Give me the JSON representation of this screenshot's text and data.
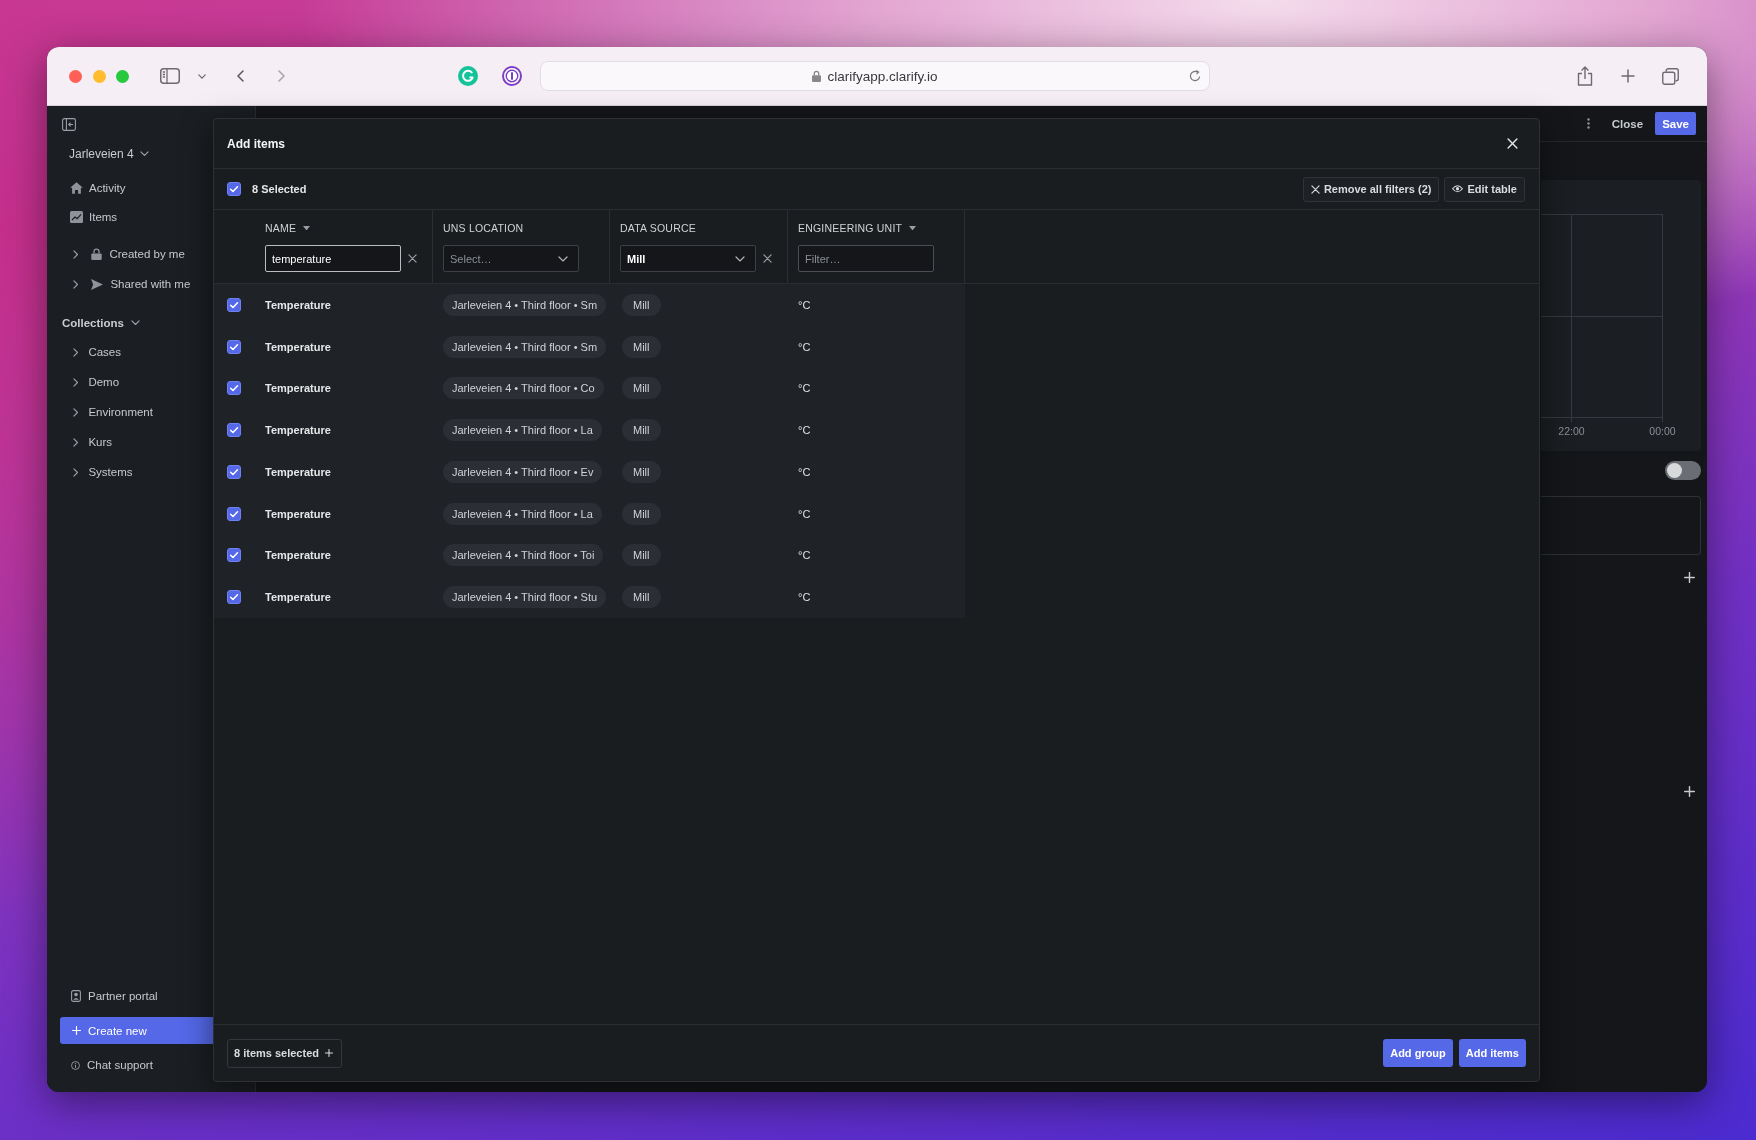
{
  "browser": {
    "url": "clarifyapp.clarify.io"
  },
  "sidebar": {
    "workspace": "Jarleveien 4",
    "nav": [
      {
        "label": "Activity"
      },
      {
        "label": "Items"
      }
    ],
    "shared": [
      {
        "label": "Created by me",
        "expanded": false
      },
      {
        "label": "Shared with me",
        "expanded": false
      }
    ],
    "collections": {
      "title": "Collections",
      "expanded": true,
      "items": [
        {
          "label": "Cases",
          "expanded": false
        },
        {
          "label": "Demo",
          "expanded": false
        },
        {
          "label": "Environment",
          "expanded": false
        },
        {
          "label": "Kurs",
          "expanded": false
        },
        {
          "label": "Systems",
          "expanded": false
        }
      ]
    },
    "footer": [
      {
        "kind": "link",
        "label": "Partner portal"
      },
      {
        "kind": "primary",
        "label": "Create new"
      },
      {
        "kind": "link",
        "label": "Chat support"
      }
    ]
  },
  "editor": {
    "actions": [
      {
        "kind": "dismiss",
        "label": "Close"
      },
      {
        "kind": "confirm",
        "label": "Save"
      }
    ],
    "chart": {
      "x_labels": [
        "22:00",
        "00:00"
      ]
    },
    "toggle": {
      "on": false
    }
  },
  "dialog": {
    "title": "Add items",
    "selection": {
      "checked": true,
      "label": "8 Selected"
    },
    "toolbar": [
      {
        "kind": "clear",
        "label": "Remove all filters (2)"
      },
      {
        "kind": "view",
        "label": "Edit table"
      }
    ],
    "table": {
      "columns": [
        {
          "label": "NAME",
          "sortable": true,
          "filter": {
            "kind": "text",
            "value": "temperature",
            "focused": true,
            "clearable": true
          }
        },
        {
          "label": "UNS LOCATION",
          "sortable": false,
          "filter": {
            "kind": "select",
            "placeholder": "Select…",
            "focused": false,
            "clearable": false
          }
        },
        {
          "label": "DATA SOURCE",
          "sortable": false,
          "filter": {
            "kind": "select",
            "value": "Mill",
            "focused": false,
            "clearable": true
          }
        },
        {
          "label": "ENGINEERING UNIT",
          "sortable": true,
          "filter": {
            "kind": "text",
            "placeholder": "Filter…",
            "focused": false,
            "clearable": false
          }
        }
      ],
      "rows": [
        {
          "selected": true,
          "name": "Temperature",
          "location": "Jarleveien 4 • Third floor • Sm",
          "source": "Mill",
          "unit": "°C"
        },
        {
          "selected": true,
          "name": "Temperature",
          "location": "Jarleveien 4 • Third floor • Sm",
          "source": "Mill",
          "unit": "°C"
        },
        {
          "selected": true,
          "name": "Temperature",
          "location": "Jarleveien 4 • Third floor • Co",
          "source": "Mill",
          "unit": "°C"
        },
        {
          "selected": true,
          "name": "Temperature",
          "location": "Jarleveien 4 • Third floor • La",
          "source": "Mill",
          "unit": "°C"
        },
        {
          "selected": true,
          "name": "Temperature",
          "location": "Jarleveien 4 • Third floor • Ev",
          "source": "Mill",
          "unit": "°C"
        },
        {
          "selected": true,
          "name": "Temperature",
          "location": "Jarleveien 4 • Third floor • La",
          "source": "Mill",
          "unit": "°C"
        },
        {
          "selected": true,
          "name": "Temperature",
          "location": "Jarleveien 4 • Third floor • Toi",
          "source": "Mill",
          "unit": "°C"
        },
        {
          "selected": true,
          "name": "Temperature",
          "location": "Jarleveien 4 • Third floor • Stu",
          "source": "Mill",
          "unit": "°C"
        }
      ]
    },
    "footer": {
      "selection": "8 items selected",
      "buttons": [
        "Add group",
        "Add items"
      ]
    }
  }
}
